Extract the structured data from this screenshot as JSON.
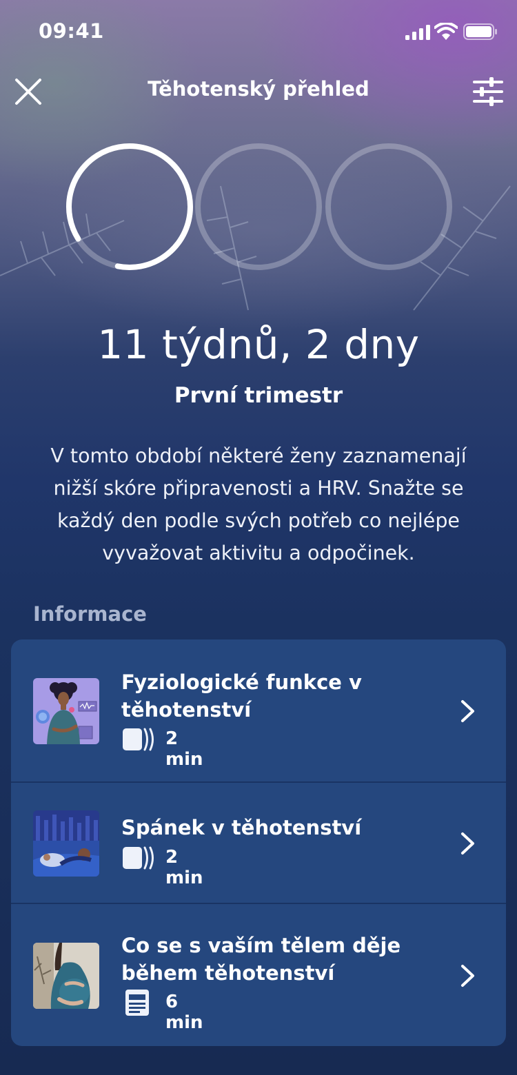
{
  "status_bar": {
    "time": "09:41"
  },
  "header": {
    "title": "Těhotenský přehled"
  },
  "progress": {
    "summary": "11 týdnů, 2 dny",
    "trimester": "První trimestr",
    "trimester_fraction": [
      0.87,
      0,
      0
    ],
    "description": "V tomto období některé ženy zaznamenají nižší skóre připravenosti a HRV. Snažte se každý den podle svých potřeb co nejlépe vyvažovat aktivitu a odpočinek."
  },
  "info": {
    "section_title": "Informace",
    "items": [
      {
        "title": "Fyziologické funkce v těhotenství",
        "duration": "2 min",
        "type_icon": "audio-icon"
      },
      {
        "title": "Spánek v těhotenství",
        "duration": "2 min",
        "type_icon": "audio-icon"
      },
      {
        "title": "Co se s vaším tělem děje během těhotenství",
        "duration": "6 min",
        "type_icon": "article-icon"
      }
    ]
  },
  "colors": {
    "card": "#25477e",
    "background_bottom": "#172a52",
    "section_title": "#a9b5cf",
    "ring_inactive": "rgba(255,255,255,0.25)"
  }
}
